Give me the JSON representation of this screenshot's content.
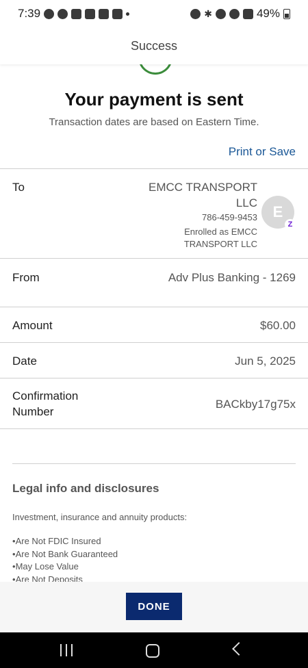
{
  "status_bar": {
    "time": "7:39",
    "battery": "49%",
    "left_icons": [
      "whatsapp-icon",
      "messages-icon",
      "ring-icon",
      "shop-icon",
      "gmail-icon",
      "app-icon"
    ],
    "right_icons": [
      "alarm-icon",
      "bluetooth-icon",
      "mute-icon",
      "wifi-icon",
      "signal-icon"
    ]
  },
  "header": {
    "title": "Success"
  },
  "confirmation": {
    "headline": "Your payment is sent",
    "subline": "Transaction dates are based on Eastern Time.",
    "print_label": "Print or Save"
  },
  "details": {
    "to": {
      "label": "To",
      "name": "EMCC TRANSPORT LLC",
      "phone": "786-459-9453",
      "enrolled": "Enrolled as EMCC TRANSPORT LLC",
      "avatar_initial": "E",
      "badge": "Z"
    },
    "from": {
      "label": "From",
      "value": "Adv Plus Banking - 1269"
    },
    "amount": {
      "label": "Amount",
      "value": "$60.00"
    },
    "date": {
      "label": "Date",
      "value": "Jun 5, 2025"
    },
    "confirmation_number": {
      "label": "Confirmation Number",
      "value": "BACkby17g75x"
    }
  },
  "legal": {
    "title": "Legal info and disclosures",
    "intro": "Investment, insurance and annuity products:",
    "items": [
      "Are Not FDIC Insured",
      "Are Not Bank Guaranteed",
      "May Lose Value",
      "Are Not Deposits"
    ]
  },
  "actions": {
    "done_label": "DONE"
  },
  "colors": {
    "link": "#1a5796",
    "button": "#0b2a6f",
    "success": "#3b8c3b",
    "zelle": "#6d1ed4"
  }
}
